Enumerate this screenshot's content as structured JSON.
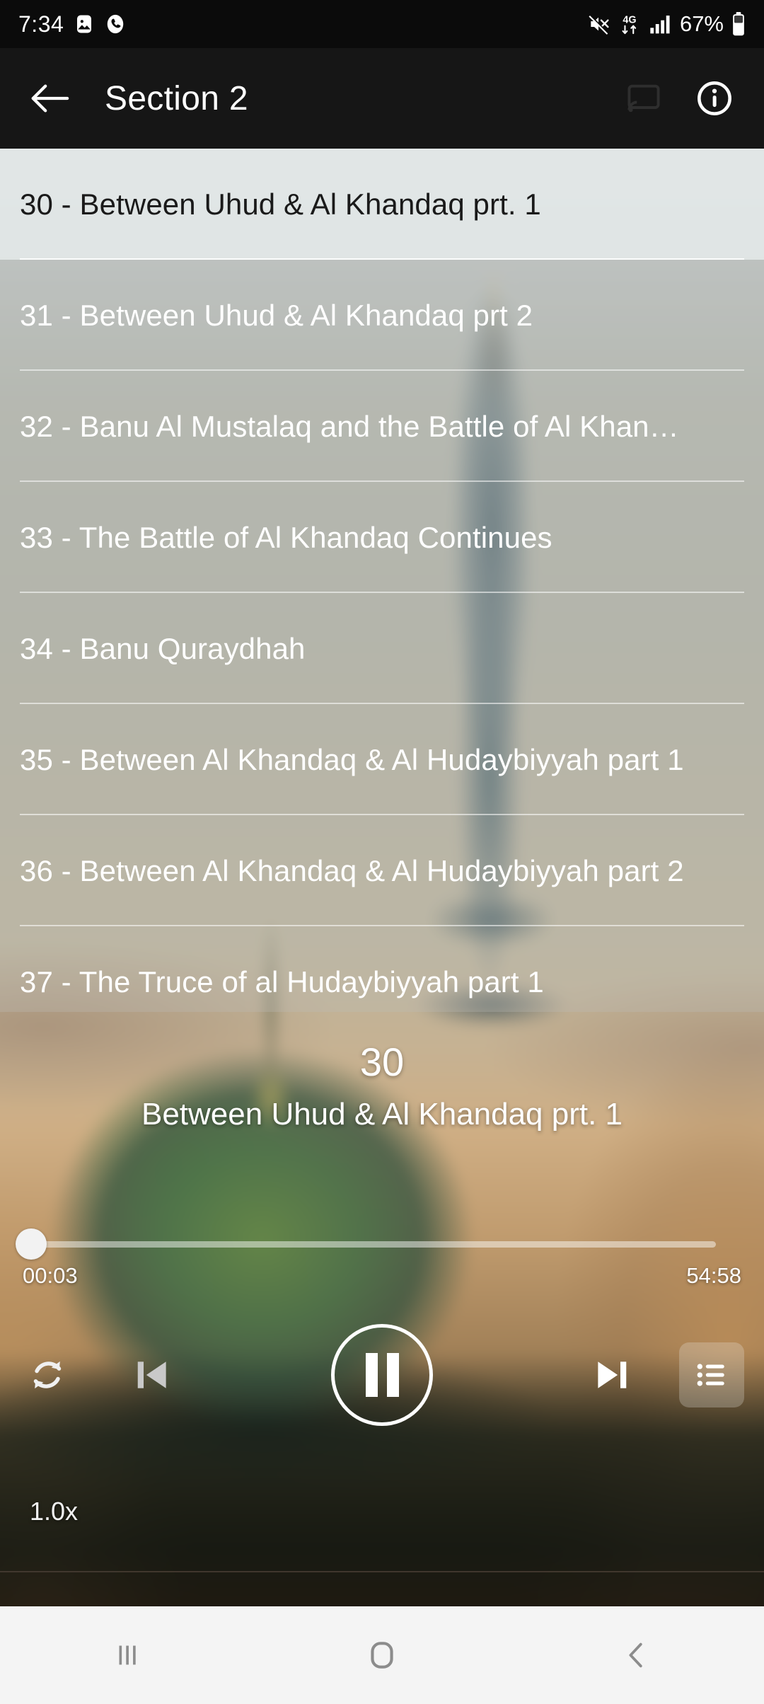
{
  "status_bar": {
    "time": "7:34",
    "battery_percent": "67%",
    "network_type": "4G",
    "icons": [
      "image-icon",
      "phone-call-icon",
      "mute-icon",
      "network-4g-icon",
      "signal-bars-icon",
      "battery-icon"
    ]
  },
  "app_bar": {
    "back_label": "back-arrow",
    "title": "Section 2",
    "actions": [
      "cast-icon",
      "info-icon"
    ]
  },
  "tracks": [
    {
      "label": "30 - Between Uhud & Al Khandaq prt. 1",
      "selected": true
    },
    {
      "label": "31 - Between Uhud & Al Khandaq prt 2",
      "selected": false
    },
    {
      "label": "32 - Banu Al Mustalaq and the Battle of Al Khan…",
      "selected": false
    },
    {
      "label": "33 - The Battle of Al Khandaq Continues",
      "selected": false
    },
    {
      "label": "34 - Banu Quraydhah",
      "selected": false
    },
    {
      "label": "35 - Between Al Khandaq & Al Hudaybiyyah part 1",
      "selected": false
    },
    {
      "label": "36 - Between Al Khandaq & Al Hudaybiyyah part 2",
      "selected": false
    },
    {
      "label": "37 - The Truce of al Hudaybiyyah part 1",
      "selected": false
    }
  ],
  "player": {
    "track_number": "30",
    "track_title": "Between Uhud & Al Khandaq prt. 1",
    "elapsed": "00:03",
    "duration": "54:58",
    "progress_percent": 0.1,
    "playback_speed": "1.0x",
    "controls": {
      "repeat": "repeat-icon",
      "previous": "skip-previous-icon",
      "play_pause": "pause-icon",
      "next": "skip-next-icon",
      "queue": "playlist-queue-icon"
    }
  },
  "nav_bar": {
    "recents": "recent-apps-icon",
    "home": "home-icon",
    "back": "back-chevron-icon"
  },
  "colors": {
    "app_bar_bg": "#161616",
    "status_bar_bg": "#0b0b0b",
    "nav_bar_bg": "#f4f4f4",
    "selected_row_bg": "#e8eeee",
    "text_on_art": "#ffffff"
  }
}
